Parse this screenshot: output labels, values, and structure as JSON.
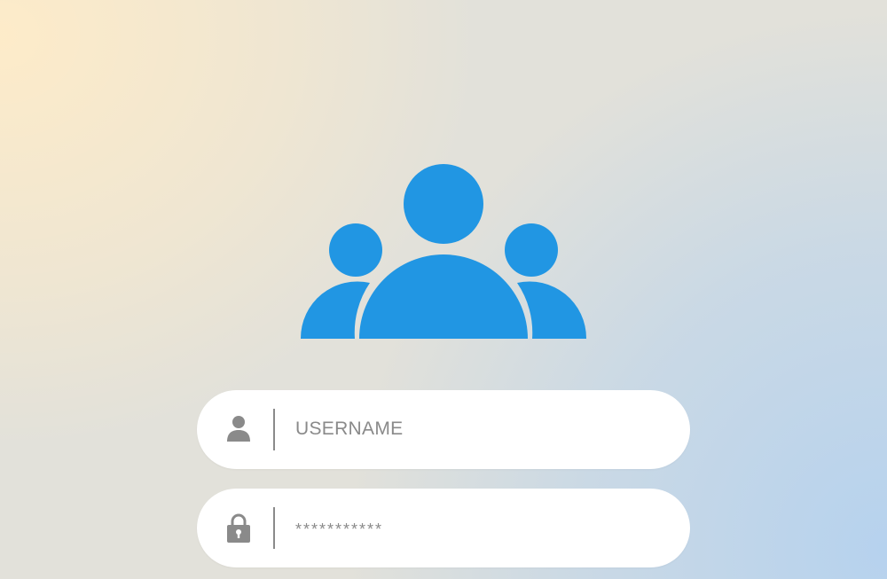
{
  "logo": {
    "icon": "users-group-icon",
    "color": "#2196e3"
  },
  "username_field": {
    "icon": "user-icon",
    "placeholder": "USERNAME",
    "value": ""
  },
  "password_field": {
    "icon": "lock-icon",
    "value": "***********"
  },
  "colors": {
    "field_background": "#ffffff",
    "icon_gray": "#8a8a8a",
    "accent_blue": "#2196e3"
  }
}
